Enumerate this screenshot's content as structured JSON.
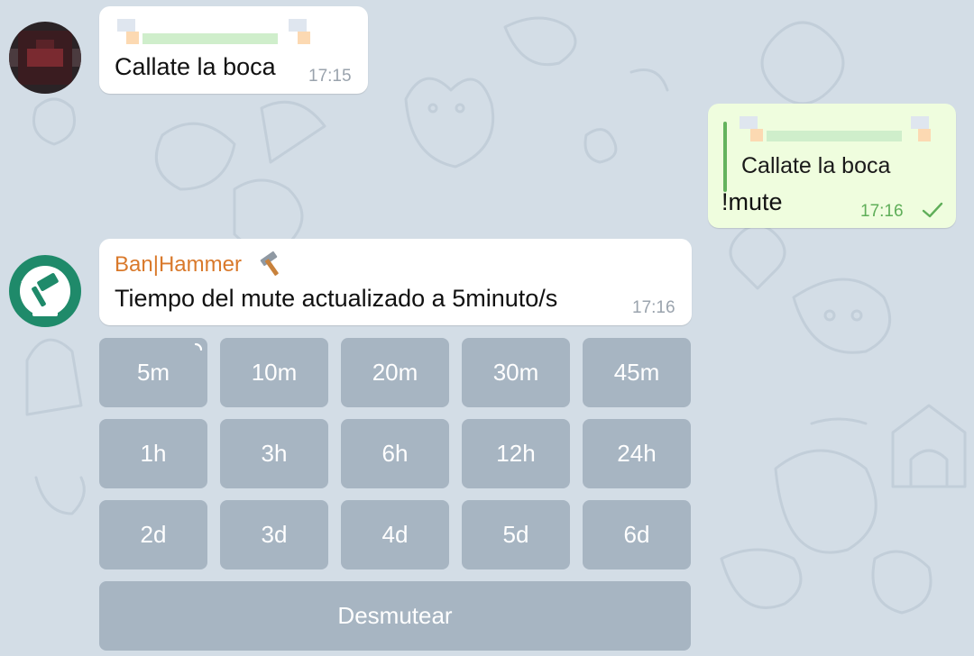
{
  "chat": {
    "messages": [
      {
        "direction": "incoming",
        "sender_name_blurred": true,
        "text": "Callate la boca",
        "time": "17:15"
      },
      {
        "direction": "outgoing",
        "reply_to": {
          "sender_name_blurred": true,
          "text": "Callate la boca"
        },
        "text": "!mute",
        "time": "17:16",
        "status_icon": "single-check-icon"
      },
      {
        "direction": "incoming",
        "sender": "Ban|Hammer",
        "sender_emoji": "hammer-icon",
        "text": "Tiempo del mute actualizado a 5minuto/s",
        "time": "17:16"
      }
    ],
    "keyboard": {
      "rows": [
        [
          "5m",
          "10m",
          "20m",
          "30m",
          "45m"
        ],
        [
          "1h",
          "3h",
          "6h",
          "12h",
          "24h"
        ],
        [
          "2d",
          "3d",
          "4d",
          "5d",
          "6d"
        ],
        [
          "Desmutear"
        ]
      ],
      "loading_button": "5m"
    },
    "colors": {
      "background": "#d3dde6",
      "incoming_bubble": "#ffffff",
      "outgoing_bubble": "#effdde",
      "sender_name": "#d9792b",
      "reply_bar": "#64b35d",
      "button_bg": "rgba(150,165,180,0.72)"
    }
  }
}
